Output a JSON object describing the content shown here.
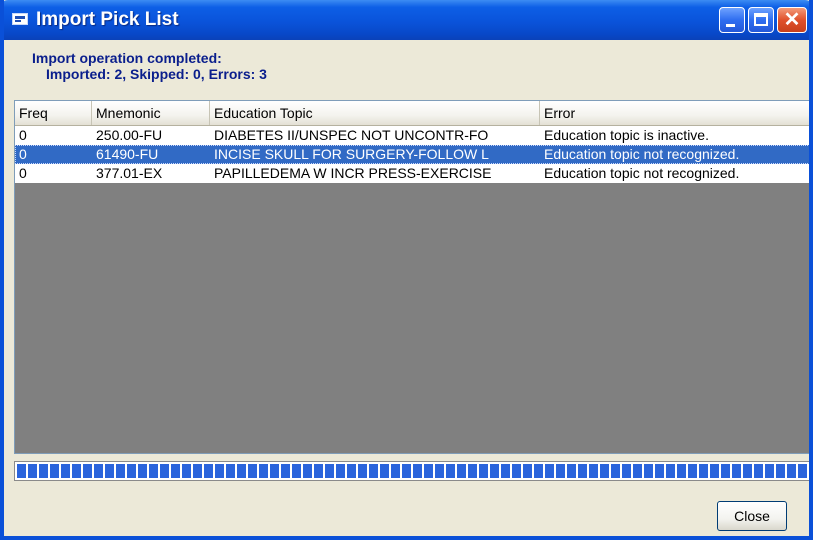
{
  "window": {
    "title": "Import Pick List",
    "close_glyph": "✕",
    "accent_color": "#0a53da"
  },
  "status": {
    "line1": "Import operation completed:",
    "line2": "Imported: 2,  Skipped: 0,  Errors: 3",
    "color": "#0a1e8c"
  },
  "table": {
    "columns": [
      "Freq",
      "Mnemonic",
      "Education Topic",
      "Error"
    ],
    "rows": [
      {
        "freq": "0",
        "mnemonic": "250.00-FU",
        "topic": "DIABETES II/UNSPEC NOT UNCONTR-FO",
        "error": "Education topic is inactive.",
        "selected": false
      },
      {
        "freq": "0",
        "mnemonic": "61490-FU",
        "topic": "INCISE SKULL FOR SURGERY-FOLLOW L",
        "error": "Education topic not recognized.",
        "selected": true
      },
      {
        "freq": "0",
        "mnemonic": "377.01-EX",
        "topic": "PAPILLEDEMA W INCR PRESS-EXERCISE",
        "error": "Education topic not recognized.",
        "selected": false
      }
    ],
    "selected_color": "#316ac5"
  },
  "progress": {
    "fraction": 1.0
  },
  "buttons": {
    "close_label": "Close"
  }
}
